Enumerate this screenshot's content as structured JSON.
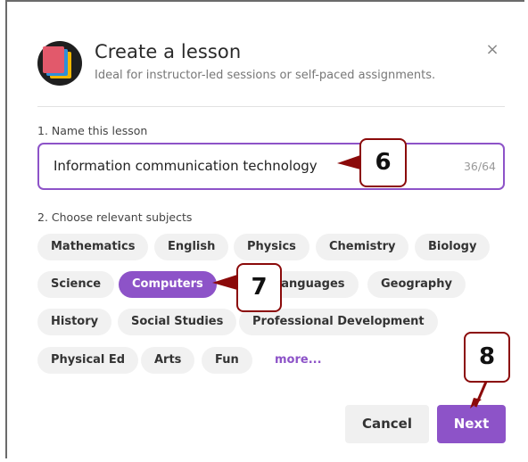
{
  "dialog": {
    "title": "Create a lesson",
    "subtitle": "Ideal for instructor-led sessions or self-paced assignments.",
    "close_label": "×"
  },
  "name_section": {
    "label": "1. Name this lesson",
    "value": "Information communication technology",
    "counter": "36/64"
  },
  "subjects_section": {
    "label": "2. Choose relevant subjects",
    "chips": [
      {
        "label": "Mathematics",
        "selected": false
      },
      {
        "label": "English",
        "selected": false
      },
      {
        "label": "Physics",
        "selected": false
      },
      {
        "label": "Chemistry",
        "selected": false
      },
      {
        "label": "Biology",
        "selected": false
      },
      {
        "label": "Science",
        "selected": false
      },
      {
        "label": "Computers",
        "selected": true
      },
      {
        "label": "Languages",
        "selected": false
      },
      {
        "label": "Geography",
        "selected": false
      },
      {
        "label": "History",
        "selected": false
      },
      {
        "label": "Social Studies",
        "selected": false
      },
      {
        "label": "Professional Development",
        "selected": false
      },
      {
        "label": "Physical Ed",
        "selected": false
      },
      {
        "label": "Arts",
        "selected": false
      },
      {
        "label": "Fun",
        "selected": false
      }
    ],
    "more_label": "more..."
  },
  "buttons": {
    "cancel": "Cancel",
    "next": "Next"
  },
  "callouts": {
    "c6": "6",
    "c7": "7",
    "c8": "8"
  },
  "colors": {
    "accent": "#8d53c8",
    "callout_border": "#8b0a0a"
  }
}
